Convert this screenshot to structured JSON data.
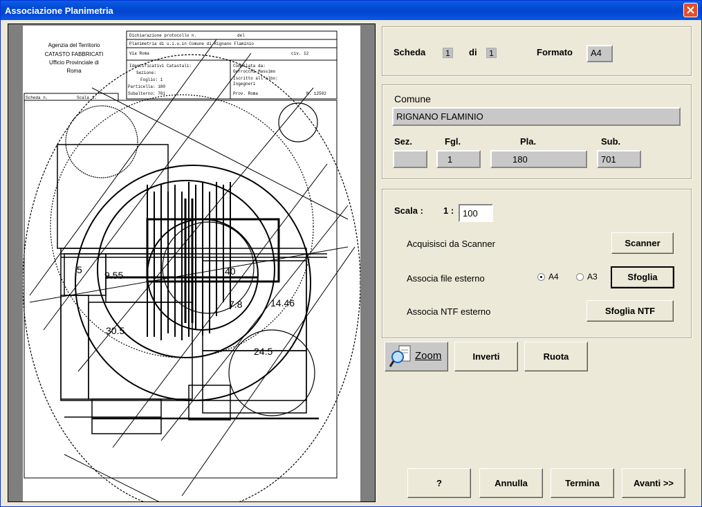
{
  "window": {
    "title": "Associazione Planimetria"
  },
  "viewer": {
    "doc_header": {
      "org_line1": "Agenzia del Territorio",
      "org_line2": "CATASTO FABBRICATI",
      "org_line3": "Ufficio Provinciale di",
      "org_line4": "Roma",
      "protocol": "Dichiarazione protocollo n.",
      "protocol_del": "del",
      "plan_desc": "Planimetria di u.i.u.in Comune di Rignano Flaminio",
      "address": "Via Roma",
      "civ": "civ. 12",
      "ident_title": "Identificativi Catastali:",
      "sezione": "Sezione:",
      "foglio": "Foglio: 1",
      "particella": "Particella: 180",
      "subalterno": "Subalterno: 701",
      "compilata": "Compilata da:",
      "compilatore": "Gerrocchi Massimo",
      "iscritto": "Iscritto all'albo:",
      "albo": "Ingegneri",
      "prov": "Prov. Roma",
      "num": "N. 12502",
      "scheda": "Scheda n.",
      "scala": "Scala 1:"
    },
    "room_labels": [
      "5",
      "9.55",
      "40",
      "7.8",
      "14.46",
      "30.5",
      "24.5"
    ]
  },
  "scheda": {
    "label": "Scheda",
    "current": "1",
    "of_label": "di",
    "total": "1",
    "formato_label": "Formato",
    "formato_value": "A4"
  },
  "comune": {
    "label": "Comune",
    "value": "RIGNANO FLAMINIO",
    "sez_label": "Sez.",
    "sez_value": "",
    "fgl_label": "Fgl.",
    "fgl_value": "1",
    "pla_label": "Pla.",
    "pla_value": "180",
    "sub_label": "Sub.",
    "sub_value": "701"
  },
  "scala": {
    "label": "Scala :",
    "prefix": "1 :",
    "value": "100"
  },
  "actions": {
    "scanner_label": "Acquisisci da Scanner",
    "scanner_button": "Scanner",
    "file_label": "Associa file esterno",
    "radio_a4": "A4",
    "radio_a3": "A3",
    "selected_format": "A4",
    "sfoglia_button": "Sfoglia",
    "ntf_label": "Associa NTF esterno",
    "ntf_button": "Sfoglia NTF"
  },
  "tools": {
    "zoom": "Zoom",
    "inverti": "Inverti",
    "ruota": "Ruota"
  },
  "footer": {
    "help": "?",
    "annulla": "Annulla",
    "termina": "Termina",
    "avanti": "Avanti >>"
  }
}
